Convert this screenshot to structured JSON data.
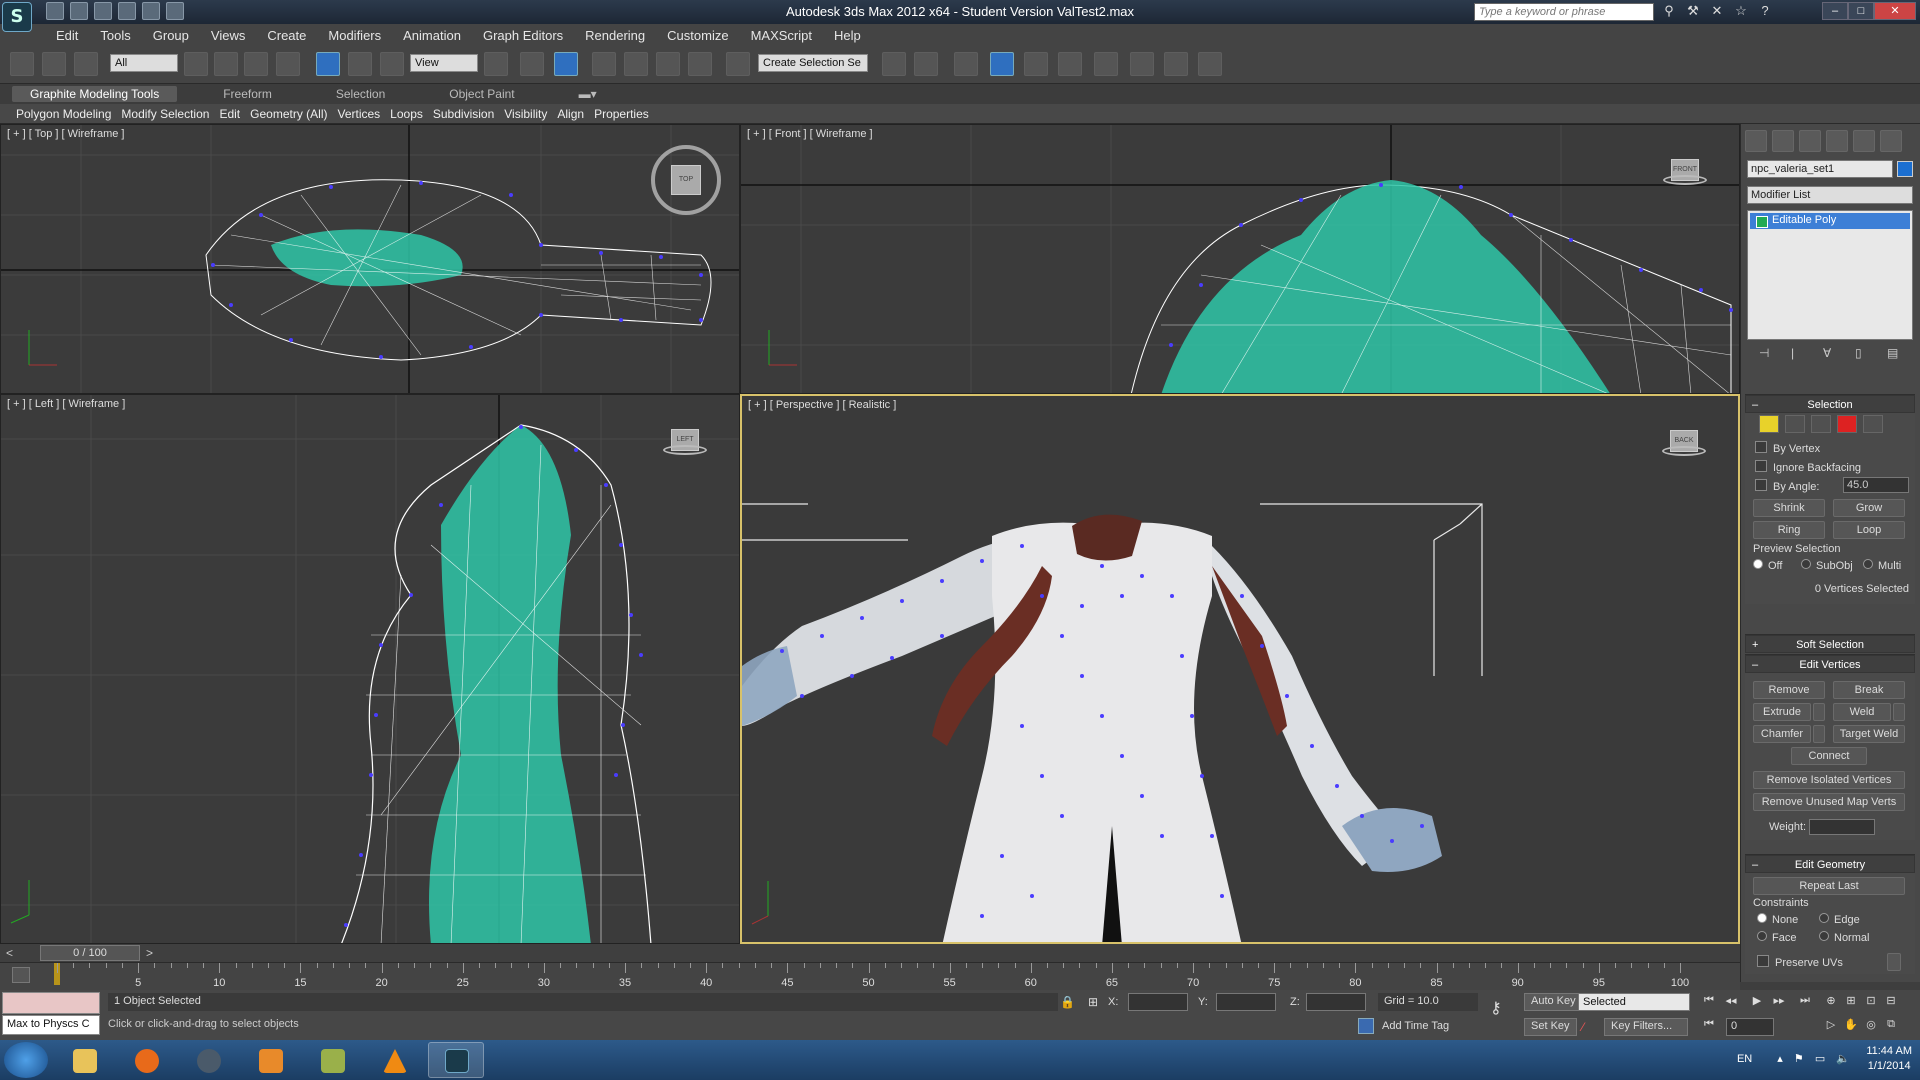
{
  "window": {
    "title": "Autodesk 3ds Max  2012 x64   - Student Version    ValTest2.max",
    "search_placeholder": "Type a keyword or phrase"
  },
  "menu": [
    "Edit",
    "Tools",
    "Group",
    "Views",
    "Create",
    "Modifiers",
    "Animation",
    "Graph Editors",
    "Rendering",
    "Customize",
    "MAXScript",
    "Help"
  ],
  "toolbar": {
    "filter_value": "All",
    "ref_coord_value": "View",
    "selection_set_value": "Create Selection Se"
  },
  "ribbon": {
    "tabs": [
      "Graphite Modeling Tools",
      "Freeform",
      "Selection",
      "Object Paint"
    ],
    "subtabs": [
      "Polygon Modeling",
      "Modify Selection",
      "Edit",
      "Geometry (All)",
      "Vertices",
      "Loops",
      "Subdivision",
      "Visibility",
      "Align",
      "Properties"
    ]
  },
  "viewports": {
    "top": {
      "label": "[ + ] [ Top ] [ Wireframe ]",
      "cube": "TOP"
    },
    "front": {
      "label": "[ + ] [ Front ] [ Wireframe ]",
      "cube": "FRONT"
    },
    "left": {
      "label": "[ + ] [ Left ] [ Wireframe ]",
      "cube": "LEFT"
    },
    "persp": {
      "label": "[ + ] [ Perspective ] [ Realistic ]",
      "cube": "BACK"
    }
  },
  "command_panel": {
    "object_name": "npc_valeria_set1",
    "object_color": "#1b6fd1",
    "modifier_list": "Modifier List",
    "stack_item": "Editable Poly",
    "selection": {
      "title": "Selection",
      "by_vertex": "By Vertex",
      "ignore_backfacing": "Ignore Backfacing",
      "by_angle": "By Angle:",
      "angle_value": "45.0",
      "shrink": "Shrink",
      "grow": "Grow",
      "ring": "Ring",
      "loop": "Loop",
      "preview_title": "Preview Selection",
      "preview_off": "Off",
      "preview_subobj": "SubObj",
      "preview_multi": "Multi",
      "status": "0 Vertices Selected"
    },
    "soft_selection": "Soft Selection",
    "edit_vertices": {
      "title": "Edit Vertices",
      "remove": "Remove",
      "break": "Break",
      "extrude": "Extrude",
      "weld": "Weld",
      "chamfer": "Chamfer",
      "target_weld": "Target Weld",
      "connect": "Connect",
      "remove_isolated": "Remove Isolated Vertices",
      "remove_unused": "Remove Unused Map Verts",
      "weight": "Weight:"
    },
    "edit_geometry": {
      "title": "Edit Geometry",
      "repeat_last": "Repeat Last",
      "constraints": "Constraints",
      "none": "None",
      "edge": "Edge",
      "face": "Face",
      "normal": "Normal",
      "preserve_uvs": "Preserve UVs"
    }
  },
  "timeline": {
    "slider": "0 / 100",
    "ticks": [
      "5",
      "10",
      "15",
      "20",
      "25",
      "30",
      "35",
      "40",
      "45",
      "50",
      "55",
      "60",
      "65",
      "70",
      "75",
      "80",
      "85",
      "90",
      "95",
      "100"
    ]
  },
  "status": {
    "maxscript_listener": "Max to Physcs C",
    "objects_selected": "1 Object Selected",
    "prompt": "Click or click-and-drag to select objects",
    "x": "X:",
    "y": "Y:",
    "z": "Z:",
    "grid": "Grid = 10.0",
    "add_time_tag": "Add Time Tag",
    "auto_key": "Auto Key",
    "set_key": "Set Key",
    "key_mode": "Selected",
    "key_filters": "Key Filters...",
    "frame": "0"
  },
  "taskbar": {
    "lang": "EN",
    "time": "11:44 AM",
    "date": "1/1/2014"
  },
  "colors": {
    "wire_mesh": "#ffffff",
    "wire_body": "#2fc7a8",
    "vertex": "#4a3cff",
    "active_border": "#d8c26a"
  }
}
